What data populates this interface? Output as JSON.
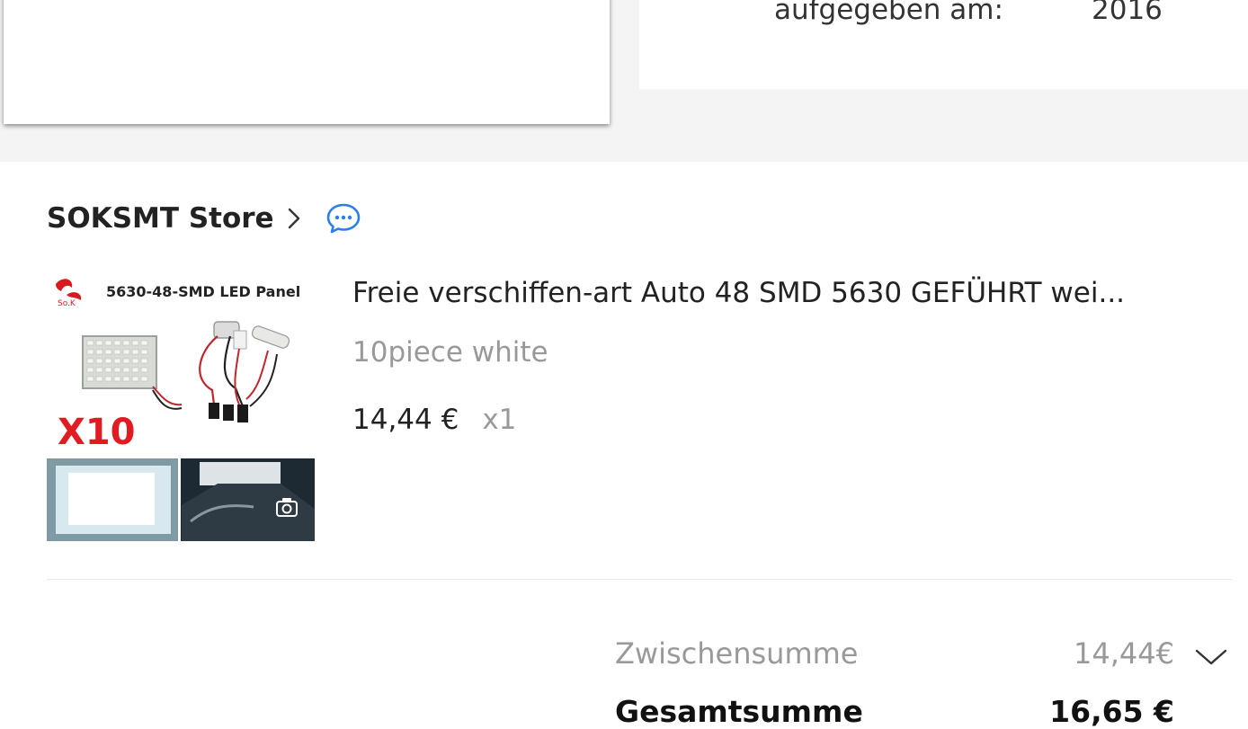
{
  "order_info": {
    "ordered_label": "aufgegeben am:",
    "ordered_value": "2016"
  },
  "store": {
    "name": "SOKSMT Store",
    "chevron_icon": "chevron-right-icon",
    "chat_icon": "chat-bubble-icon",
    "accent": "#1a73e8"
  },
  "product": {
    "image_text": {
      "brand": "So.K",
      "heading": "5630-48-SMD LED Panel",
      "quantity_mark": "X10"
    },
    "title": "Freie verschiffen-art Auto 48 SMD 5630 GEFÜHRT wei...",
    "variant": "10piece white",
    "price": "14,44 €",
    "quantity": "x1",
    "camera_icon": "camera-icon"
  },
  "summary": {
    "subtotal_label": "Zwischensumme",
    "subtotal_value": "14,44€",
    "expand_icon": "chevron-down-icon",
    "total_label": "Gesamtsumme",
    "total_value": "16,65 €"
  }
}
